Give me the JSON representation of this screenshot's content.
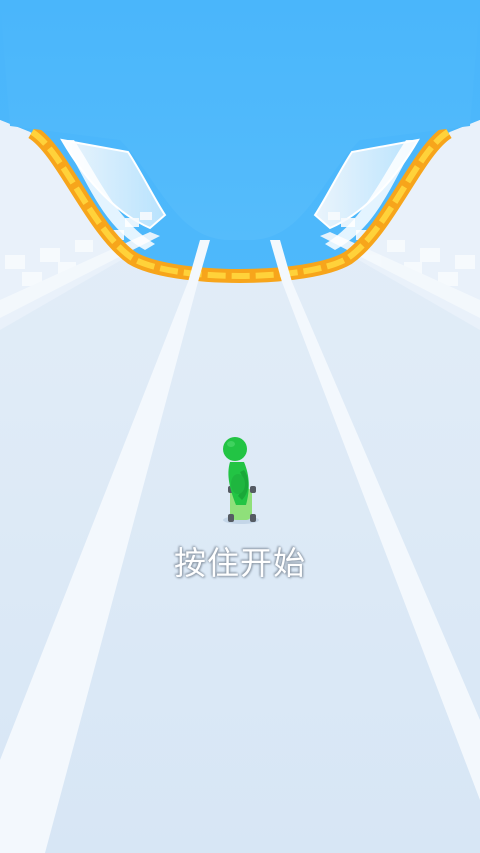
{
  "game": {
    "prompt_text": "按住开始"
  },
  "colors": {
    "sky": "#4db8fb",
    "track": "#dce9f6",
    "lane_stripe": "#f3f8fd",
    "ramp_orange": "#f7a51b",
    "ramp_yellow": "#ffd23a",
    "player_green": "#22c444",
    "board_green": "#8fe07a"
  },
  "icons": {
    "player": "stick-figure-on-skateboard"
  }
}
